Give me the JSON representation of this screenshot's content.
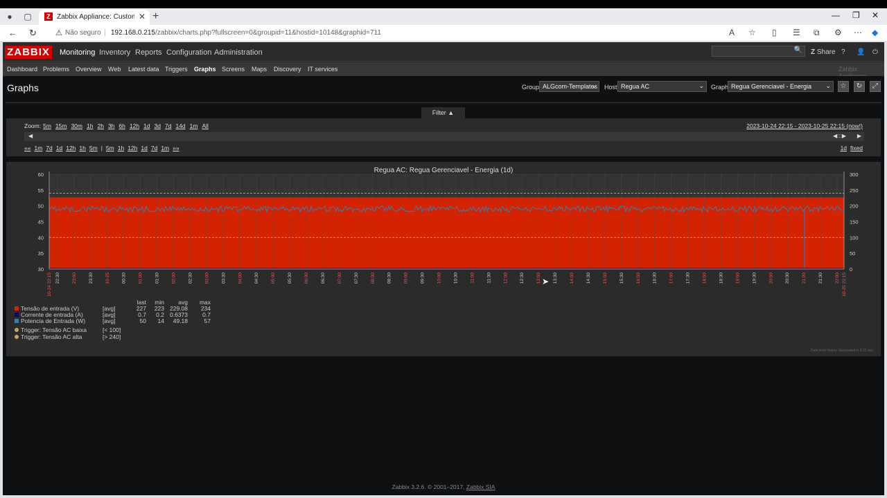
{
  "browser": {
    "tab_title": "Zabbix Appliance: Custom graph",
    "tab_favicon": "Z",
    "security_label": "Não seguro",
    "url_host": "192.168.0.215",
    "url_path": "/zabbix/charts.php?fullscreen=0&groupid=11&hostid=10148&graphid=711"
  },
  "topnav": {
    "logo": "ZABBIX",
    "menu": [
      "Monitoring",
      "Inventory",
      "Reports",
      "Configuration",
      "Administration"
    ],
    "share": "Share",
    "help": "?"
  },
  "subnav": {
    "items": [
      "Dashboard",
      "Problems",
      "Overview",
      "Web",
      "Latest data",
      "Triggers",
      "Graphs",
      "Screens",
      "Maps",
      "Discovery",
      "IT services"
    ],
    "appliance": "Zabbix Appliance"
  },
  "header": {
    "title": "Graphs",
    "group_label": "Group",
    "group_value": "ALGcom-Templates",
    "host_label": "Host",
    "host_value": "Regua AC",
    "graph_label": "Graph",
    "graph_value": "Regua Gerenciavel - Energia"
  },
  "filter": {
    "tab_label": "Filter ▲",
    "zoom_label": "Zoom:",
    "zoom_options": [
      "5m",
      "15m",
      "30m",
      "1h",
      "2h",
      "3h",
      "6h",
      "12h",
      "1d",
      "3d",
      "7d",
      "14d",
      "1m",
      "All"
    ],
    "period": "2023-10-24 22:15 - 2023-10-25 22:15 (now!)",
    "nav_back": [
      "««",
      "1m",
      "7d",
      "1d",
      "12h",
      "1h",
      "5m",
      "|"
    ],
    "nav_fwd": [
      "5m",
      "1h",
      "12h",
      "1d",
      "7d",
      "1m",
      "»»"
    ],
    "duration": "1d",
    "fixed": "fixed"
  },
  "chart_data": {
    "type": "area",
    "title": "Regua AC: Regua Gerenciavel - Energia (1d)",
    "y_left": {
      "min": 30,
      "max": 60,
      "ticks": [
        60,
        55,
        50,
        45,
        40,
        35,
        30
      ]
    },
    "y_right": {
      "min": 0,
      "max": 300,
      "ticks": [
        300,
        250,
        200,
        150,
        100,
        50,
        0
      ]
    },
    "x_start_label": "10-24 22:15",
    "x_end_label": "10-25 22:15",
    "x_ticks": [
      "22:30",
      "23:00",
      "23:30",
      "10-25",
      "00:30",
      "01:00",
      "01:30",
      "02:00",
      "02:30",
      "03:00",
      "03:30",
      "04:00",
      "04:30",
      "05:00",
      "05:30",
      "06:00",
      "06:30",
      "07:00",
      "07:30",
      "08:00",
      "08:30",
      "09:00",
      "09:30",
      "10:00",
      "10:30",
      "11:00",
      "11:30",
      "12:00",
      "12:30",
      "13:00",
      "13:30",
      "14:00",
      "14:30",
      "15:00",
      "15:30",
      "16:00",
      "16:30",
      "17:00",
      "17:30",
      "18:00",
      "18:30",
      "19:00",
      "19:30",
      "20:00",
      "20:30",
      "21:00",
      "21:30",
      "22:00"
    ],
    "series": [
      {
        "name": "Tensão de entrada (V)",
        "color": "#d42300",
        "axis": "right",
        "level": 227
      },
      {
        "name": "Corrente de entrada (A)",
        "color": "#0a0a66",
        "axis": "left",
        "level": 0.7
      },
      {
        "name": "Potencia de Entrada (W)",
        "color": "#2f7fb8",
        "axis": "left",
        "level": 49
      }
    ],
    "triggers": [
      {
        "name": "Trigger: Tensão AC baixa",
        "cond": "[< 100]",
        "value": 100,
        "color": "#b8a76c"
      },
      {
        "name": "Trigger: Tensão AC alta",
        "cond": "[> 240]",
        "value": 240,
        "color": "#b8a76c"
      }
    ],
    "legend_headers": [
      "last",
      "min",
      "avg",
      "max"
    ],
    "legend_rows": [
      {
        "name": "Tensão de entrada (V)",
        "fn": "[avg]",
        "last": "227",
        "min": "223",
        "avg": "229.08",
        "max": "234"
      },
      {
        "name": "Corrente de entrada (A)",
        "fn": "[avg]",
        "last": "0.7",
        "min": "0.2",
        "avg": "0.6373",
        "max": "0.7"
      },
      {
        "name": "Potencia de Entrada (W)",
        "fn": "[avg]",
        "last": "50",
        "min": "14",
        "avg": "49.18",
        "max": "57"
      }
    ]
  },
  "graph_note": "Data from history. Generated in 0.31 sec.",
  "footer": {
    "text": "Zabbix 3.2.6. © 2001–2017, ",
    "link": "Zabbix SIA"
  }
}
